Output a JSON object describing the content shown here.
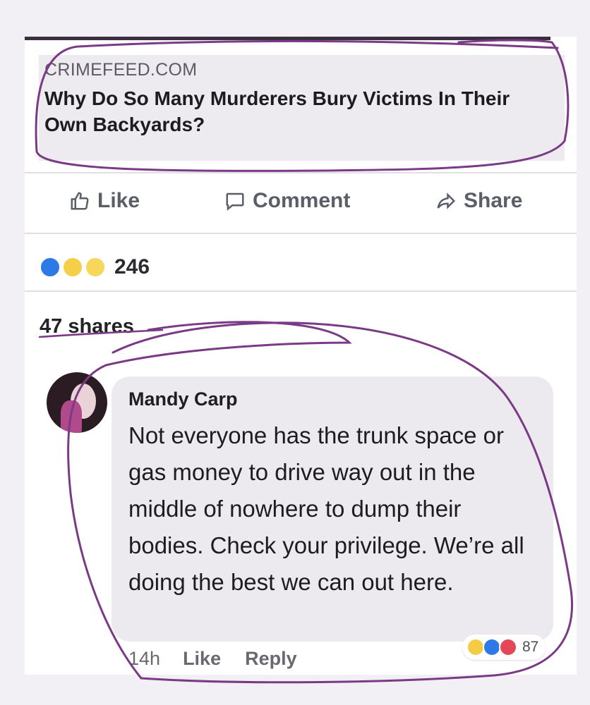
{
  "post": {
    "link_domain": "CRIMEFEED.COM",
    "link_headline": "Why Do So Many Murderers Bury Victims In Their Own Backyards?"
  },
  "actions": {
    "like_label": "Like",
    "comment_label": "Comment",
    "share_label": "Share"
  },
  "reactions": {
    "icons": [
      "like-reaction-icon",
      "wow-reaction-icon",
      "haha-reaction-icon"
    ],
    "count": "246"
  },
  "shares_text": "47 shares",
  "comment": {
    "author": "Mandy Carp",
    "text": "Not everyone has the trunk space or gas money to drive way out in the middle of nowhere to dump their bodies. Check your privilege. We’re all doing the best we can out here.",
    "time": "14h",
    "like_label": "Like",
    "reply_label": "Reply",
    "reaction_icons": [
      "haha-reaction-icon",
      "like-reaction-icon",
      "love-reaction-icon"
    ],
    "reaction_count": "87"
  },
  "colors": {
    "annotation_ink": "#7a3a86",
    "like_blue": "#2d7ae6"
  }
}
